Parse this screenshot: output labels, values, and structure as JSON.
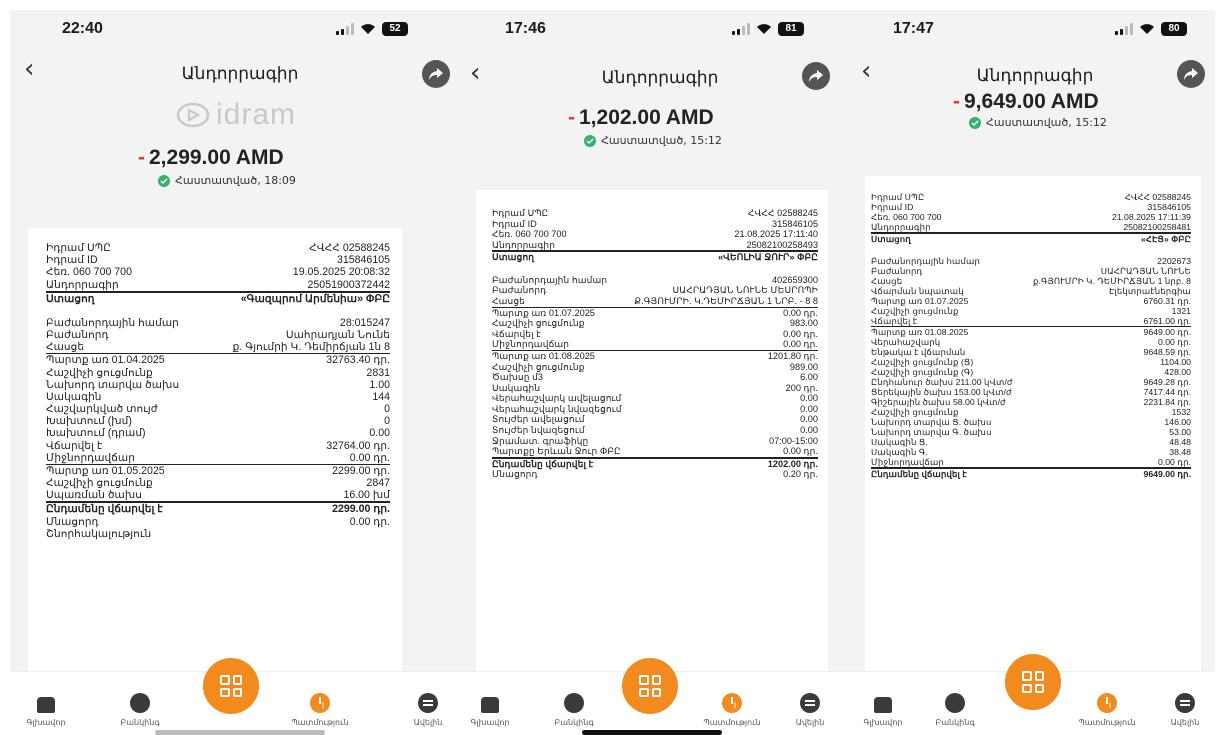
{
  "screens": [
    {
      "status": {
        "time": "22:40",
        "battery": "52"
      },
      "title": "Անդորրագիր",
      "brand": "idram",
      "amount": {
        "sign": "-",
        "value": "2,299.00 AMD"
      },
      "confirmation": "Հաստատված, 18:09",
      "rows": [
        {
          "k": "Իդրամ ՍՊԸ",
          "v": "ՀՎՀՀ 02588245"
        },
        {
          "k": "Իդրամ ID",
          "v": "315846105"
        },
        {
          "k": "Հեռ. 060 700 700",
          "v": "19.05.2025 20:08:32"
        },
        {
          "k": "Անդորրագիր",
          "v": "25051900372442"
        },
        {
          "k": "Ստացող",
          "v": "«Գազպրոմ Արմենիա» ՓԲԸ"
        },
        {
          "k": "Բաժանորդային համար",
          "v": "28:015247"
        },
        {
          "k": "Բաժանորդ",
          "v": "Սահրադյան Նունե"
        },
        {
          "k": "Հասցե",
          "v": "ք. Գյումրի Կ. Դեմիրճյան 1ն 8"
        },
        {
          "k": "Պարտք առ 01.04.2025",
          "v": "32763.40 դր."
        },
        {
          "k": "Հաշվիչի ցուցմունք",
          "v": "2831"
        },
        {
          "k": "Նախորդ տարվա ծախս",
          "v": "1.00"
        },
        {
          "k": "Սակագին",
          "v": "144"
        },
        {
          "k": "Հաշվարկված տույժ",
          "v": "0"
        },
        {
          "k": "Խախտում (խմ)",
          "v": "0"
        },
        {
          "k": "Խախտում (դրամ)",
          "v": "0.00"
        },
        {
          "k": "Վճարվել է",
          "v": "32764.00 դր."
        },
        {
          "k": "Միջնորդավճար",
          "v": "0.00 դր."
        },
        {
          "k": "Պարտք առ 01.05.2025",
          "v": "2299.00 դր."
        },
        {
          "k": "Հաշվիչի ցուցմունք",
          "v": "2847"
        },
        {
          "k": "Սպառման ծախս",
          "v": "16.00 խմ"
        },
        {
          "k": "Ընդամենը վճարվել է",
          "v": "2299.00 դր."
        },
        {
          "k": "Մնացորդ",
          "v": "0.00 դր."
        },
        {
          "k": "Շնորհակալություն",
          "v": ""
        }
      ]
    },
    {
      "status": {
        "time": "17:46",
        "battery": "81"
      },
      "title": "Անդորրագիր",
      "amount": {
        "sign": "-",
        "value": "1,202.00 AMD"
      },
      "confirmation": "Հաստատված, 15:12",
      "rows": [
        {
          "k": "Իդրամ ՍՊԸ",
          "v": "ՀՎՀՀ 02588245"
        },
        {
          "k": "Իդրամ ID",
          "v": "315846105"
        },
        {
          "k": "Հեռ. 060 700 700",
          "v": "21.08.2025 17:11:40"
        },
        {
          "k": "Անդորրագիր",
          "v": "25082100258493"
        },
        {
          "k": "Ստացող",
          "v": "«ՎԵՈԼԻԱ ՋՈՒՐ» ՓԲԸ"
        },
        {
          "k": "Բաժանորդային համար",
          "v": "402659300"
        },
        {
          "k": "Բաժանորդ",
          "v": "ՍԱՀՐԱԴՅԱՆ ՆՈՒՆԵ ՄԵՍՐՈՊԻ"
        },
        {
          "k": "Հասցե",
          "v": "Ք.ԳՅՈՒՄՐԻ. Կ.ԴԵՄԻՐՃՅԱՆ 1 ՆՐԲ. - 8 8"
        },
        {
          "k": "Պարտք առ 01.07.2025",
          "v": "0.00 դր."
        },
        {
          "k": "Հաշվիչի ցուցմունք",
          "v": "983.00"
        },
        {
          "k": "Վճարվել է",
          "v": "0.00 դր."
        },
        {
          "k": "Միջնորդավճար",
          "v": "0.00 դր."
        },
        {
          "k": "Պարտք առ 01.08.2025",
          "v": "1201.80 դր."
        },
        {
          "k": "Հաշվիչի ցուցմունք",
          "v": "989.00"
        },
        {
          "k": "Ծախսը մ3",
          "v": "6.00"
        },
        {
          "k": "Սակագին",
          "v": "200 դր."
        },
        {
          "k": "Վերահաշվարկ ավելացում",
          "v": "0.00"
        },
        {
          "k": "Վերահաշվարկ նվազեցում",
          "v": "0.00"
        },
        {
          "k": "Տույժեր ավելացում",
          "v": "0.00"
        },
        {
          "k": "Տույժեր նվազեցում",
          "v": "0.00"
        },
        {
          "k": "Ջրամատ. գրաֆիկը",
          "v": "07:00-15:00"
        },
        {
          "k": "Պարտքը Երևան Ջուր ՓԲԸ",
          "v": "0.00 դր."
        },
        {
          "k": "Ընդամենը վճարվել է",
          "v": "1202.00 դր."
        },
        {
          "k": "Մնացորդ",
          "v": "0.20 դր."
        }
      ]
    },
    {
      "status": {
        "time": "17:47",
        "battery": "80"
      },
      "title": "Անդորրագիր",
      "amount": {
        "sign": "-",
        "value": "9,649.00 AMD"
      },
      "confirmation": "Հաստատված, 15:12",
      "rows": [
        {
          "k": "Իդրամ ՍՊԸ",
          "v": "ՀՎՀՀ 02588245"
        },
        {
          "k": "Իդրամ ID",
          "v": "315846105"
        },
        {
          "k": "Հեռ. 060 700 700",
          "v": "21.08.2025 17:11:39"
        },
        {
          "k": "Անդորրագիր",
          "v": "25082100258481"
        },
        {
          "k": "Ստացող",
          "v": "«ՀԷՑ» ՓԲԸ"
        },
        {
          "k": "Բաժանորդային համար",
          "v": "2202673"
        },
        {
          "k": "Բաժանորդ",
          "v": "ՍԱՀՐԱԴՅԱՆ ՆՈՒՆԵ"
        },
        {
          "k": "Հասցե",
          "v": "ք.ԳՅՈՒՄՐԻ Կ. ԴԵՄԻՐՃՅԱՆ 1 նրբ. 8"
        },
        {
          "k": "Վճարման նպատակ",
          "v": "Էլեկտրաէներգիա"
        },
        {
          "k": "Պարտք առ 01.07.2025",
          "v": "6760.31 դր."
        },
        {
          "k": "Հաշվիչի ցուցմունք",
          "v": "1321"
        },
        {
          "k": "Վճարվել է",
          "v": "6761.00 դր."
        },
        {
          "k": "Պարտք առ 01.08.2025",
          "v": "9649.00 դր."
        },
        {
          "k": "Վերահաշվարկ",
          "v": "0.00 դր."
        },
        {
          "k": "Ենթակա է վճարման",
          "v": "9648.59 դր."
        },
        {
          "k": "Հաշվիչի ցուցմունք (Ց)",
          "v": "1104.00"
        },
        {
          "k": "Հաշվիչի ցուցմունք (Գ)",
          "v": "428.00"
        },
        {
          "k": "Ընդհանուր ծախս 211.00 կՎտ/ժ",
          "v": "9649.28 դր."
        },
        {
          "k": "Ցերեկային ծախս 153.00 կՎտ/ժ",
          "v": "7417.44 դր."
        },
        {
          "k": "Գիշերային ծախս 58.00 կՎտ/ժ",
          "v": "2231.84 դր."
        },
        {
          "k": "Հաշվիչի ցուցմունք",
          "v": "1532"
        },
        {
          "k": "Նախորդ տարվա Ց. ծախս",
          "v": "146.00"
        },
        {
          "k": "Նախորդ տարվա Գ. ծախս",
          "v": "53.00"
        },
        {
          "k": "Սակագին Ց.",
          "v": "48.48"
        },
        {
          "k": "Սակագին Գ.",
          "v": "38.48"
        },
        {
          "k": "Միջնորդավճար",
          "v": "0.00 դր."
        },
        {
          "k": "Ընդամենը վճարվել է",
          "v": "9649.00 դր."
        }
      ]
    }
  ],
  "tabs": {
    "home": "Գլխավոր",
    "banking": "Բանկինգ",
    "history": "Պատմություն",
    "more": "Ավելին"
  },
  "icons": {
    "back": "chevron-left-icon",
    "share": "share-arrow-icon",
    "qr": "qr-code-icon",
    "home": "home-icon",
    "banking": "bank-icon",
    "history": "clock-icon",
    "more": "menu-icon"
  },
  "colors": {
    "minus": "#e53935",
    "accent": "#f28a1e",
    "confirm": "#34b36b"
  }
}
